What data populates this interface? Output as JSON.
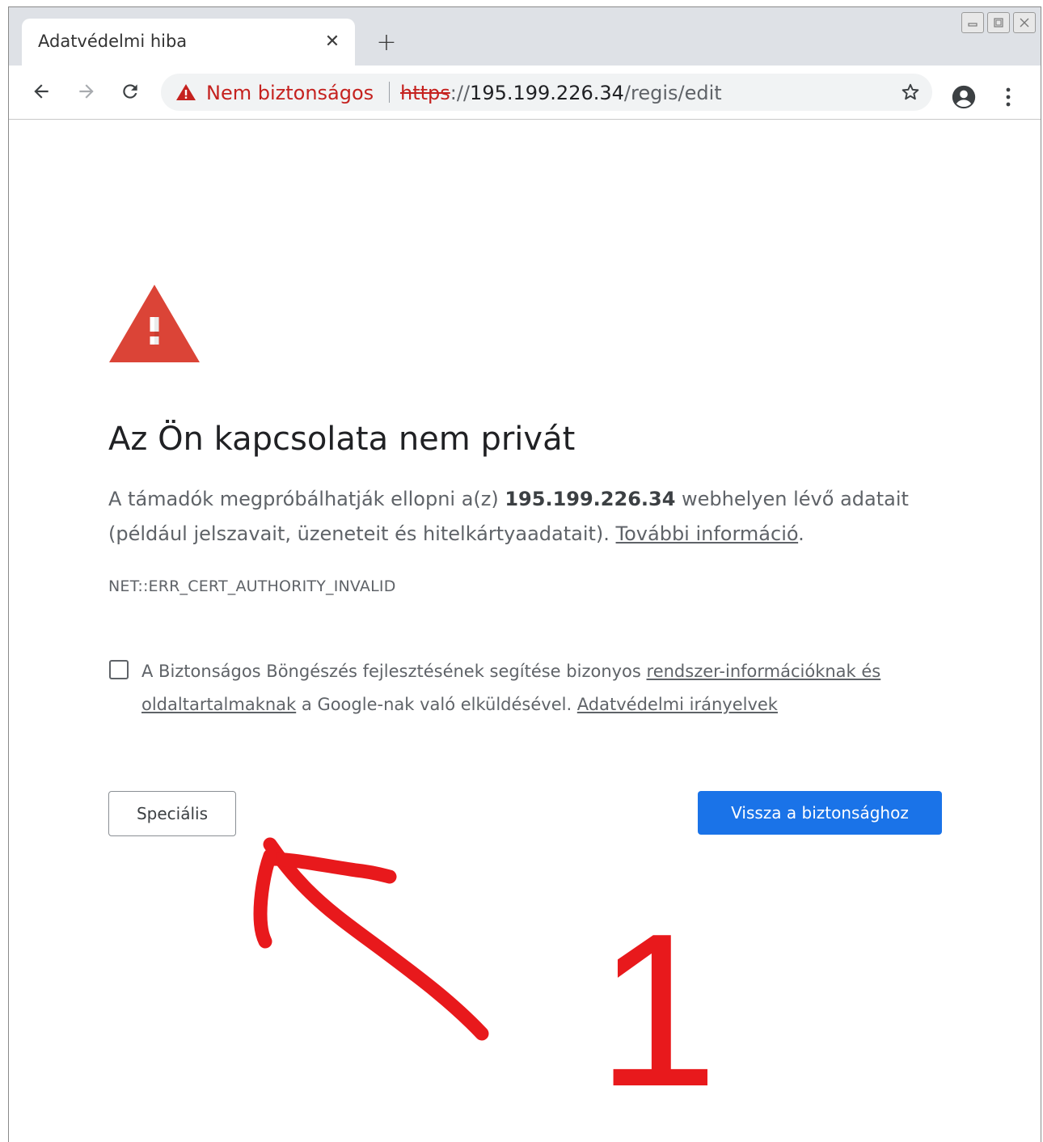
{
  "tab": {
    "title": "Adatvédelmi hiba",
    "close_glyph": "✕"
  },
  "new_tab_glyph": "+",
  "omnibox": {
    "security_label": "Nem biztonságos",
    "url_scheme": "https",
    "url_sep": "://",
    "url_host": "195.199.226.34",
    "url_path": "/regis/edit"
  },
  "page": {
    "heading": "Az Ön kapcsolata nem privát",
    "para_before": "A támadók megpróbálhatják ellopni a(z) ",
    "para_host": "195.199.226.34",
    "para_after": " webhelyen lévő adatait (például jelszavait, üzeneteit és hitelkártyaadatait). ",
    "more_info_link": "További információ",
    "para_end": ".",
    "error_code": "NET::ERR_CERT_AUTHORITY_INVALID",
    "checkbox_text_before": "A Biztonságos Böngészés fejlesztésének segítése bizonyos ",
    "checkbox_link": "rendszer-információknak és oldaltartalmaknak",
    "checkbox_text_after": " a Google-nak való elküldésével. ",
    "privacy_link": "Adatvédelmi irányelvek",
    "advanced_button": "Speciális",
    "back_button": "Vissza a biztonsághoz"
  },
  "annotation": {
    "number": "1",
    "color": "#e8191c"
  },
  "colors": {
    "accent": "#1a73e8",
    "danger": "#c5221f",
    "warning_icon": "#db4437"
  }
}
